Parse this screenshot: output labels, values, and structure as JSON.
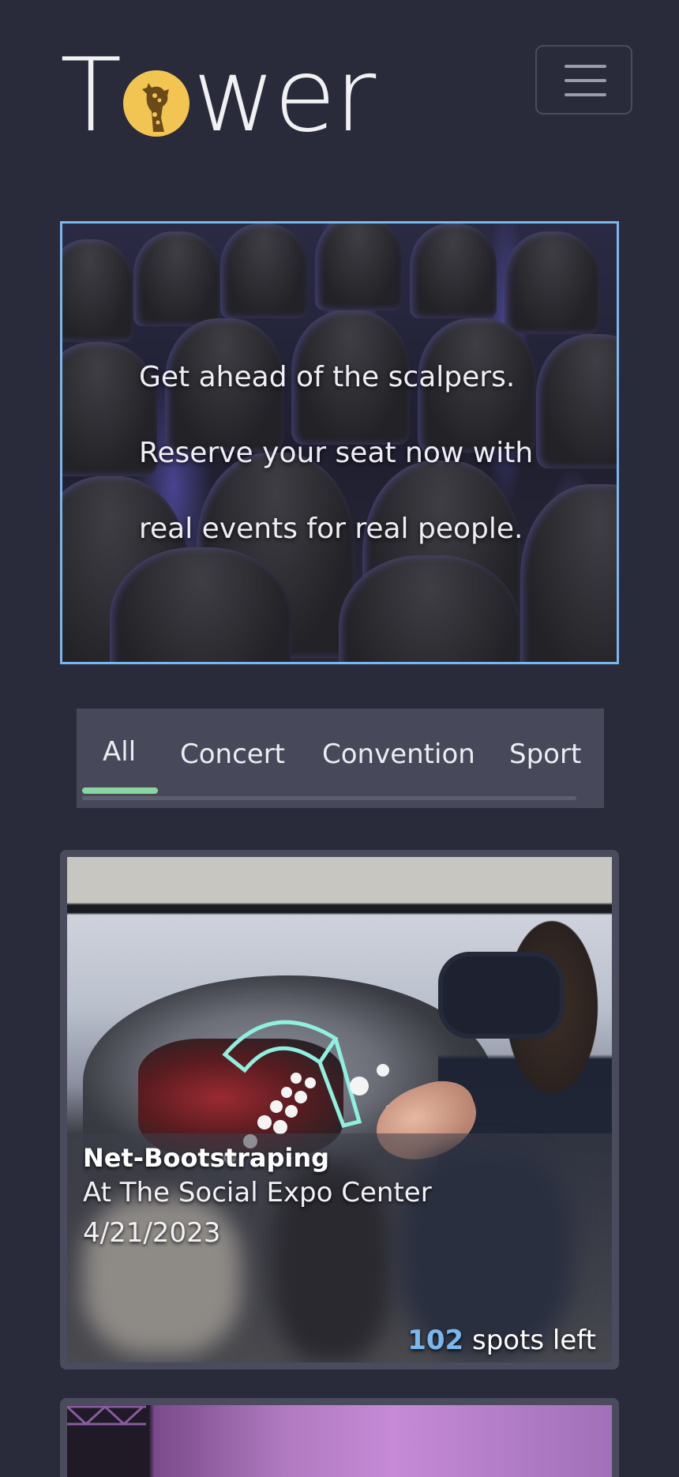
{
  "header": {
    "logo_text_left": "T",
    "logo_text_right": "wer",
    "logo_alt": "Tower",
    "menu_icon": "hamburger-menu-icon"
  },
  "hero": {
    "lines": [
      "Get ahead of the scalpers.",
      "Reserve your seat now with",
      "real events for real people."
    ]
  },
  "tabs": {
    "items": [
      {
        "label": "All",
        "active": true
      },
      {
        "label": "Concert",
        "active": false
      },
      {
        "label": "Convention",
        "active": false
      },
      {
        "label": "Sport",
        "active": false
      }
    ],
    "active_color": "#8ad6a0"
  },
  "events": [
    {
      "title": "Net-Bootstraping",
      "venue": "At The Social Expo Center",
      "date": "4/21/2023",
      "spots_count": "102",
      "spots_suffix": " spots left"
    }
  ],
  "colors": {
    "background": "#2a2b3a",
    "accent_blue": "#7ab7ee",
    "logo_gold": "#f2c552",
    "card_bg": "#4a4b5c"
  }
}
